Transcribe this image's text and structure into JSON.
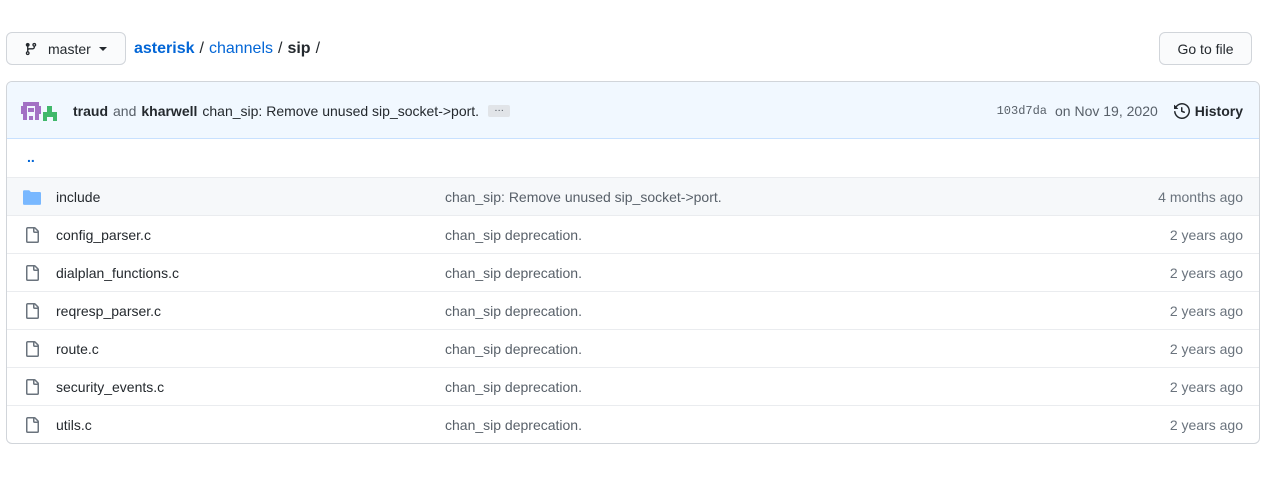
{
  "branch": {
    "label": "master",
    "icon": "git-branch-icon"
  },
  "breadcrumb": {
    "root": "asterisk",
    "folder": "channels",
    "current": "sip",
    "separator": "/"
  },
  "goto_file_label": "Go to file",
  "commit": {
    "author1": "traud",
    "conjunction": "and",
    "author2": "kharwell",
    "message": "chan_sip: Remove unused sip_socket->port.",
    "ellipsis": "…",
    "sha": "103d7da",
    "date": "on Nov 19, 2020",
    "history_label": "History",
    "history_icon": "history-icon"
  },
  "parent_dir": "..",
  "files": [
    {
      "name": "include",
      "type": "folder",
      "icon": "folder-icon",
      "message": "chan_sip: Remove unused sip_socket->port.",
      "age": "4 months ago"
    },
    {
      "name": "config_parser.c",
      "type": "file",
      "icon": "file-icon",
      "message": "chan_sip deprecation.",
      "age": "2 years ago"
    },
    {
      "name": "dialplan_functions.c",
      "type": "file",
      "icon": "file-icon",
      "message": "chan_sip deprecation.",
      "age": "2 years ago"
    },
    {
      "name": "reqresp_parser.c",
      "type": "file",
      "icon": "file-icon",
      "message": "chan_sip deprecation.",
      "age": "2 years ago"
    },
    {
      "name": "route.c",
      "type": "file",
      "icon": "file-icon",
      "message": "chan_sip deprecation.",
      "age": "2 years ago"
    },
    {
      "name": "security_events.c",
      "type": "file",
      "icon": "file-icon",
      "message": "chan_sip deprecation.",
      "age": "2 years ago"
    },
    {
      "name": "utils.c",
      "type": "file",
      "icon": "file-icon",
      "message": "chan_sip deprecation.",
      "age": "2 years ago"
    }
  ],
  "colors": {
    "link": "#0366d6",
    "folder": "#79b8ff",
    "commit_bg": "#f1f8ff"
  }
}
